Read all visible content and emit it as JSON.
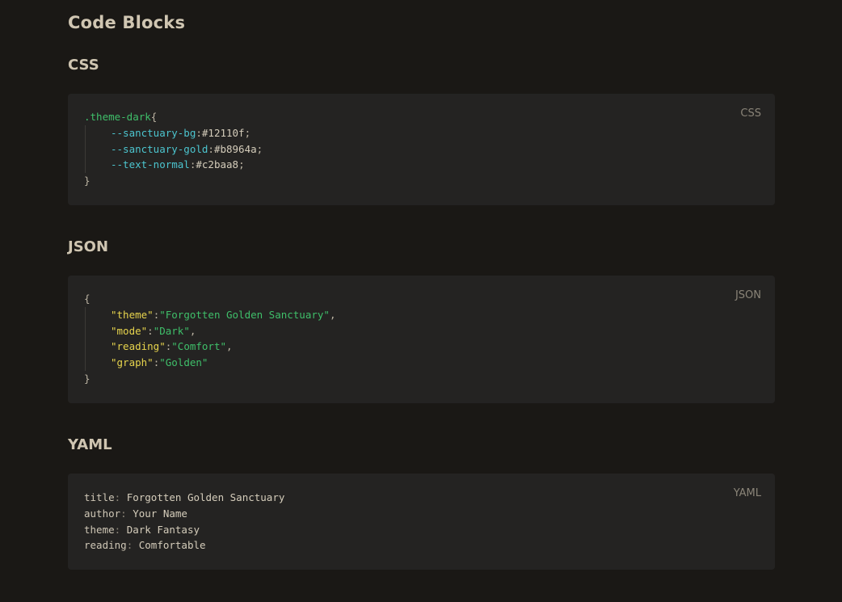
{
  "page": {
    "title": "Code Blocks"
  },
  "sections": {
    "css": {
      "heading": "CSS",
      "lang_label": "CSS",
      "selector": ".theme-dark",
      "open_brace": "{",
      "close_brace": "}",
      "declarations": [
        {
          "prop": "--sanctuary-bg",
          "value": "#12110f"
        },
        {
          "prop": "--sanctuary-gold",
          "value": "#b8964a"
        },
        {
          "prop": "--text-normal",
          "value": "#c2baa8"
        }
      ]
    },
    "json": {
      "heading": "JSON",
      "lang_label": "JSON",
      "open_brace": "{",
      "close_brace": "}",
      "entries": [
        {
          "key": "\"theme\"",
          "value": "\"Forgotten Golden Sanctuary\"",
          "comma": ","
        },
        {
          "key": "\"mode\"",
          "value": "\"Dark\"",
          "comma": ","
        },
        {
          "key": "\"reading\"",
          "value": "\"Comfort\"",
          "comma": ","
        },
        {
          "key": "\"graph\"",
          "value": "\"Golden\"",
          "comma": ""
        }
      ]
    },
    "yaml": {
      "heading": "YAML",
      "lang_label": "YAML",
      "entries": [
        {
          "key": "title",
          "value": "Forgotten Golden Sanctuary"
        },
        {
          "key": "author",
          "value": "Your Name"
        },
        {
          "key": "theme",
          "value": "Dark Fantasy"
        },
        {
          "key": "reading",
          "value": "Comfortable"
        }
      ]
    }
  },
  "colors": {
    "background": "#1a1815",
    "code_background": "#242322",
    "selector": "#3fbf6a",
    "property": "#4cc5cf",
    "json_key": "#e7d44d",
    "string": "#3fbf6a"
  }
}
